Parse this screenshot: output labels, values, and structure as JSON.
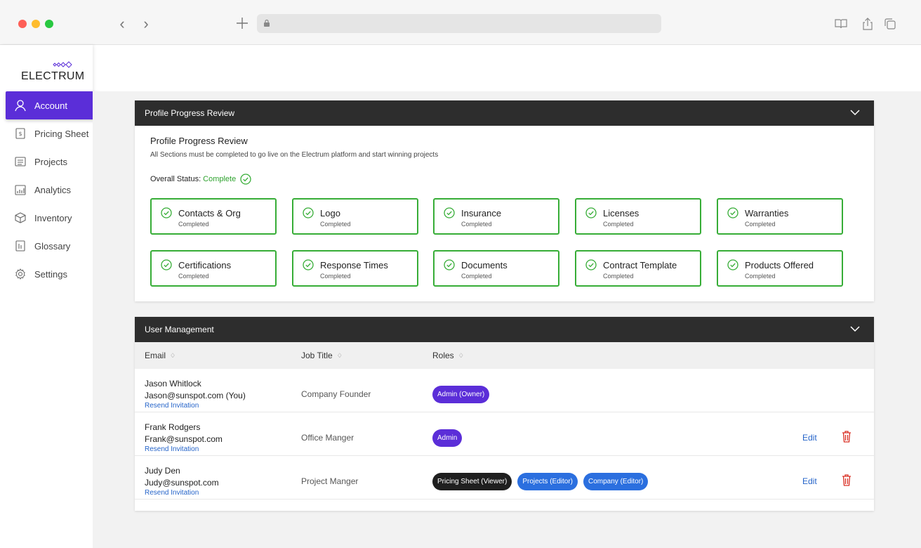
{
  "brand": {
    "name": "ELECTRUM"
  },
  "sidebar": {
    "items": [
      {
        "label": "Account",
        "icon": "user-icon"
      },
      {
        "label": "Pricing Sheet",
        "icon": "pricing-sheet-icon"
      },
      {
        "label": "Projects",
        "icon": "projects-icon"
      },
      {
        "label": "Analytics",
        "icon": "analytics-icon"
      },
      {
        "label": "Inventory",
        "icon": "inventory-box-icon"
      },
      {
        "label": "Glossary",
        "icon": "glossary-icon"
      },
      {
        "label": "Settings",
        "icon": "gear-icon"
      }
    ],
    "active": "Account"
  },
  "profile_panel": {
    "header": "Profile Progress Review",
    "title": "Profile Progress Review",
    "subtitle": "All Sections must be completed to go live on the Electrum platform and start winning projects",
    "overall_label": "Overall Status:",
    "overall_value": "Complete",
    "sections": [
      {
        "title": "Contacts & Org",
        "status": "Completed"
      },
      {
        "title": "Logo",
        "status": "Completed"
      },
      {
        "title": "Insurance",
        "status": "Completed"
      },
      {
        "title": "Licenses",
        "status": "Completed"
      },
      {
        "title": "Warranties",
        "status": "Completed"
      },
      {
        "title": "Certifications",
        "status": "Completed"
      },
      {
        "title": "Response Times",
        "status": "Completed"
      },
      {
        "title": "Documents",
        "status": "Completed"
      },
      {
        "title": "Contract Template",
        "status": "Completed"
      },
      {
        "title": "Products Offered",
        "status": "Completed"
      }
    ]
  },
  "user_panel": {
    "header": "User Management",
    "columns": [
      "Email",
      "Job Title",
      "Roles"
    ],
    "sort_glyph": "♢",
    "resend_label": "Resend Invitation",
    "edit_label": "Edit",
    "users": [
      {
        "name": "Jason Whitlock",
        "email": "Jason@sunspot.com (You)",
        "job": "Company Founder",
        "roles": [
          {
            "text": "Admin (Owner)",
            "style": "purple"
          }
        ]
      },
      {
        "name": "Frank Rodgers",
        "email": "Frank@sunspot.com",
        "job": "Office Manger",
        "roles": [
          {
            "text": "Admin",
            "style": "purple"
          }
        ]
      },
      {
        "name": "Judy Den",
        "email": "Judy@sunspot.com",
        "job": "Project Manger",
        "roles": [
          {
            "text": "Pricing Sheet (Viewer)",
            "style": "black"
          },
          {
            "text": "Projects (Editor)",
            "style": "blue"
          },
          {
            "text": "Company (Editor)",
            "style": "blue"
          }
        ]
      }
    ]
  },
  "colors": {
    "accent": "#5b2ed8",
    "success": "#37ad37",
    "link": "#2564c9",
    "danger": "#d93025",
    "header_dark": "#2d2d2d"
  }
}
